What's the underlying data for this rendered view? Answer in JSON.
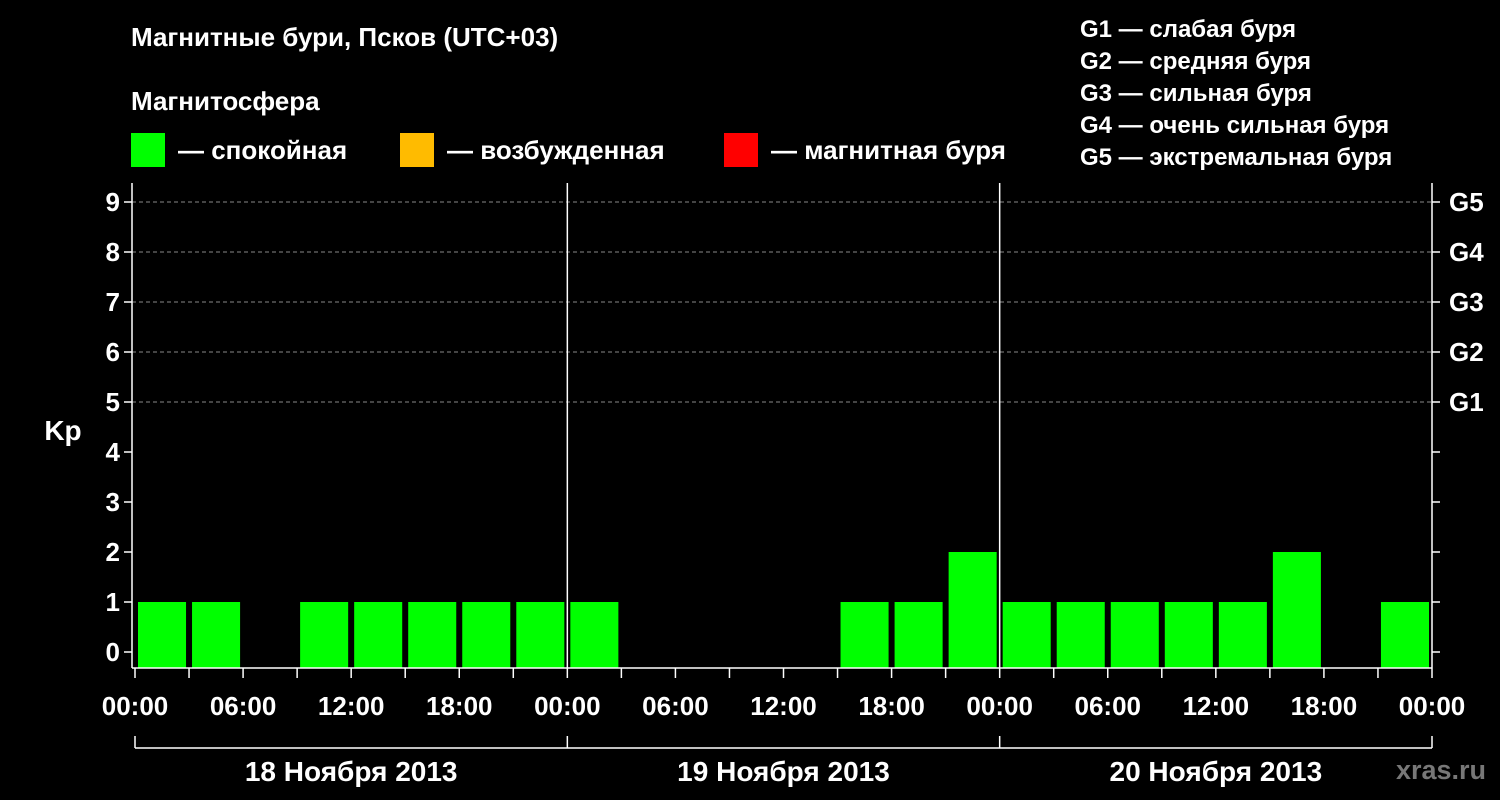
{
  "title": "Магнитные бури, Псков (UTC+03)",
  "magnetosphere_title": "Магнитосфера",
  "legend": [
    {
      "label": "— спокойная",
      "color": "#00ff00"
    },
    {
      "label": "— возбужденная",
      "color": "#ffbb00"
    },
    {
      "label": "— магнитная буря",
      "color": "#ff0000"
    }
  ],
  "storm_scale": [
    "G1 — слабая буря",
    "G2 — средняя буря",
    "G3 — сильная буря",
    "G4 — очень сильная буря",
    "G5 — экстремальная буря"
  ],
  "watermark": "xras.ru",
  "chart_data": {
    "type": "bar",
    "ylabel": "Kp",
    "ylim": [
      0,
      9
    ],
    "y_ticks": [
      "0",
      "1",
      "2",
      "3",
      "4",
      "5",
      "6",
      "7",
      "8",
      "9"
    ],
    "right_axis_labels": [
      {
        "kp": 5,
        "label": "G1"
      },
      {
        "kp": 6,
        "label": "G2"
      },
      {
        "kp": 7,
        "label": "G3"
      },
      {
        "kp": 8,
        "label": "G4"
      },
      {
        "kp": 9,
        "label": "G5"
      }
    ],
    "x_tick_labels": [
      "00:00",
      "06:00",
      "12:00",
      "18:00",
      "00:00",
      "06:00",
      "12:00",
      "18:00",
      "00:00",
      "06:00",
      "12:00",
      "18:00",
      "00:00"
    ],
    "days": [
      "18 Ноября 2013",
      "19 Ноября 2013",
      "20 Ноября 2013"
    ],
    "interval_hours": 3,
    "series": [
      {
        "values": [
          1,
          1,
          0,
          1,
          1,
          1,
          1,
          1,
          1,
          0,
          0,
          0,
          0,
          1,
          1,
          2,
          1,
          1,
          1,
          1,
          1,
          2,
          0,
          1
        ]
      }
    ],
    "gridlines": "dashed at 5-9",
    "colors": {
      "quiet": "#00ff00"
    }
  }
}
